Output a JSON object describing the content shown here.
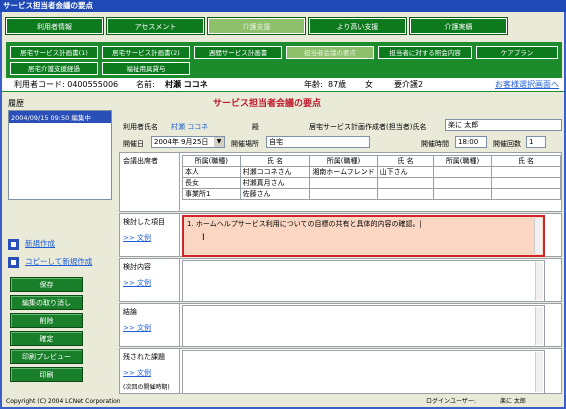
{
  "window": {
    "title": "サービス担当者会議の要点"
  },
  "nav_main": [
    {
      "label": "利用者情報"
    },
    {
      "label": "アセスメント"
    },
    {
      "label": "介護支援"
    },
    {
      "label": "より高い支援"
    },
    {
      "label": "介護実績"
    }
  ],
  "nav_sub": [
    {
      "label": "居宅サービス計画書(1)"
    },
    {
      "label": "居宅サービス計画書(2)"
    },
    {
      "label": "週間サービス計画書"
    },
    {
      "label": "担当者会議の要点"
    },
    {
      "label": "担当者に対する照会内容"
    },
    {
      "label": "ケアプラン"
    },
    {
      "label": "居宅介護支援経過"
    },
    {
      "label": "福祉用具貸与"
    }
  ],
  "info": {
    "user_code": "利用者コード: 0400555006",
    "name_label": "名前:",
    "name": "村瀬 ココネ",
    "age_label": "年齢:",
    "age": "87歳",
    "sex": "女",
    "care_level": "要介護2",
    "select_link": "お客様選択画面へ"
  },
  "history": {
    "label": "履歴",
    "items": [
      {
        "text": "2004/09/15 09:50 編集中"
      }
    ]
  },
  "actions": {
    "new": "新規作成",
    "copy_new": "コピーして新規作成",
    "save": "保存",
    "cancel_edit": "編集の取り消し",
    "delete": "削除",
    "confirm": "確定",
    "print_preview": "印刷プレビュー",
    "print": "印刷"
  },
  "form": {
    "title": "サービス担当者会議の要点",
    "user_name_label": "利用者氏名",
    "user_name": "村瀬 ココネ",
    "honorific": "殿",
    "planner_label": "居宅サービス計画作成者(担当者)氏名",
    "planner": "楽に 太郎",
    "date_label": "開催日",
    "date": "2004年 9月25日",
    "place_label": "開催場所",
    "place": "自宅",
    "time_label": "開催時間",
    "time": "18:00",
    "count_label": "開催回数",
    "count": "1"
  },
  "attendees": {
    "label": "会議出席者",
    "headers": [
      "所属(職種)",
      "氏 名",
      "所属(職種)",
      "氏 名",
      "所属(職種)",
      "氏 名"
    ],
    "rows": [
      [
        "本人",
        "村瀬ココネさん",
        "湘南ホームフレンド",
        "山下さん",
        "",
        ""
      ],
      [
        "長女",
        "村瀬真月さん",
        "",
        "",
        "",
        ""
      ],
      [
        "事業所1",
        "佐藤さん",
        "",
        "",
        "",
        ""
      ]
    ]
  },
  "sections": {
    "examine": {
      "label": "検討した項目",
      "example": ">> 文例",
      "text": "1. ホームヘルプサービス利用についての目標の共有と具体的内容の確認。|"
    },
    "content": {
      "label": "検討内容",
      "example": ">> 文例"
    },
    "conclusion": {
      "label": "結論",
      "example": ">> 文例"
    },
    "remaining": {
      "label": "残された課題",
      "example": ">> 文例",
      "note": "(次回の開催時期)"
    }
  },
  "footer": {
    "copyright": "Copyright (C) 2004 LCNet Corporation",
    "login_label": "ログインユーザー:",
    "login_user": "楽に 太郎"
  }
}
